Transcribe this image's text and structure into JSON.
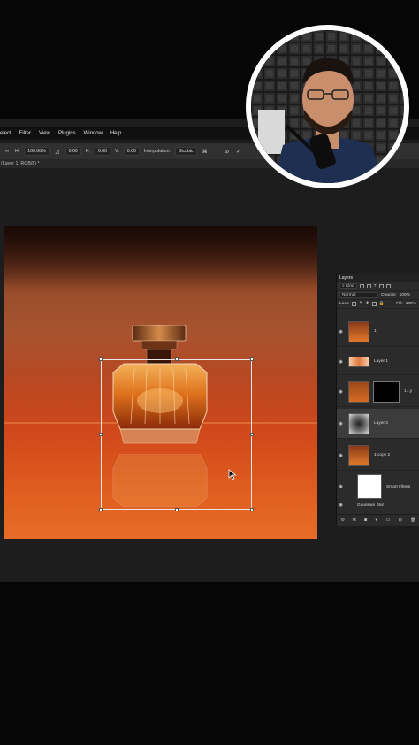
{
  "menubar": {
    "items": [
      "elect",
      "Filter",
      "View",
      "Plugins",
      "Window",
      "Help"
    ]
  },
  "options": {
    "h_label": "H:",
    "h_value": "100.00%",
    "angle_value": "0.00",
    "hskew_label": "H:",
    "hskew_value": "0.00",
    "vskew_label": "V:",
    "vskew_value": "0.00",
    "interp_label": "Interpolation:",
    "interp_value": "Bicubic"
  },
  "document": {
    "tab_title": "(Layer 1, RGB/8) *"
  },
  "layers_panel": {
    "title": "Layers",
    "kind_label": "Kind",
    "blend_mode": "Normal",
    "opacity_label": "Opacity:",
    "opacity_value": "100%",
    "lock_label": "Lock:",
    "fill_label": "Fill:",
    "fill_value": "100%",
    "layers": [
      {
        "name": "1"
      },
      {
        "name": "Layer 1"
      },
      {
        "name": "1...y"
      },
      {
        "name": "Layer 2"
      },
      {
        "name": "1 copy 2"
      },
      {
        "name": "Smart Filters"
      },
      {
        "name": "Gaussian Blur"
      }
    ]
  },
  "colors": {
    "accent": "#e05a1f",
    "panel": "#2b2b2b",
    "app_bg": "#1d1d1d"
  }
}
